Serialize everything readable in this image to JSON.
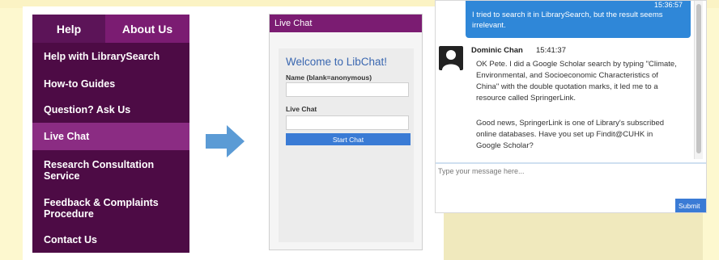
{
  "menu": {
    "tabs": {
      "help": "Help",
      "about": "About Us"
    },
    "items": [
      "Help with LibrarySearch",
      "How-to Guides",
      "Question? Ask Us",
      "Live Chat",
      "Research Consultation Service",
      "Feedback & Complaints Procedure",
      "Contact Us"
    ],
    "active_item": "Live Chat",
    "colors": {
      "menu_bg": "#4d0b45",
      "active_bg": "#8b2c83"
    }
  },
  "widget": {
    "header": "Live Chat",
    "welcome": "Welcome to LibChat!",
    "name_label": "Name (blank=anonymous)",
    "name_value": "",
    "chat_label": "Live Chat",
    "chat_value": "",
    "start_button": "Start Chat"
  },
  "chat": {
    "user_message": {
      "time": "15:36:57",
      "text": "I tried to search it in LibrarySearch, but the result seems irrelevant."
    },
    "agent": {
      "name": "Dominic Chan",
      "time": "15:41:37",
      "message1": "OK Pete. I did a Google Scholar search by typing \"Climate, Environmental, and Socioeconomic Characteristics of China\" with the double quotation marks, it led me to a resource called SpringerLink.",
      "message2": "Good news, SpringerLink is one of Library's subscribed online databases. Have you set up Findit@CUHK in Google Scholar?"
    },
    "input_placeholder": "Type your message here...",
    "submit_label": "Submit"
  },
  "icons": {
    "arrow": "right-arrow-icon",
    "avatar": "user-avatar-icon"
  }
}
